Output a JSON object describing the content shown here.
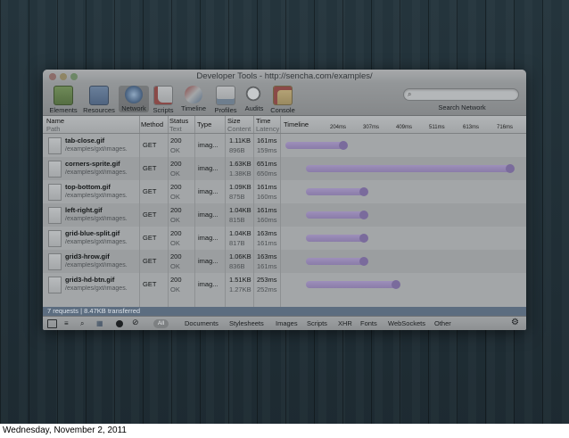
{
  "window": {
    "title": "Developer Tools - http://sencha.com/examples/"
  },
  "toolbar": {
    "items": [
      {
        "label": "Elements",
        "icon": "elements-icon"
      },
      {
        "label": "Resources",
        "icon": "resources-icon"
      },
      {
        "label": "Network",
        "icon": "network-icon"
      },
      {
        "label": "Scripts",
        "icon": "scripts-icon"
      },
      {
        "label": "Timeline",
        "icon": "timeline-icon"
      },
      {
        "label": "Profiles",
        "icon": "profiles-icon"
      },
      {
        "label": "Audits",
        "icon": "audits-icon"
      },
      {
        "label": "Console",
        "icon": "console-icon"
      }
    ],
    "search_label": "Search Network"
  },
  "headers": {
    "name": "Name",
    "path": "Path",
    "method": "Method",
    "status": "Status",
    "text": "Text",
    "type": "Type",
    "size": "Size",
    "content": "Content",
    "time": "Time",
    "latency": "Latency",
    "timeline": "Timeline",
    "ticks": [
      "204ms",
      "307ms",
      "409ms",
      "511ms",
      "613ms",
      "716ms"
    ]
  },
  "rows": [
    {
      "name": "tab-close.gif",
      "path": "/examples/gxt/images.",
      "method": "GET",
      "status": "200",
      "text": "OK",
      "type": "imag...",
      "size": "1.11KB",
      "content": "896B",
      "time": "161ms",
      "latency": "159ms",
      "bar_start": 0.0,
      "bar_end": 0.27
    },
    {
      "name": "corners-sprite.gif",
      "path": "/examples/gxt/images.",
      "method": "GET",
      "status": "200",
      "text": "OK",
      "type": "imag...",
      "size": "1.63KB",
      "content": "1.38KB",
      "time": "651ms",
      "latency": "650ms",
      "bar_start": 0.09,
      "bar_end": 1.0
    },
    {
      "name": "top-bottom.gif",
      "path": "/examples/gxt/images.",
      "method": "GET",
      "status": "200",
      "text": "OK",
      "type": "imag...",
      "size": "1.09KB",
      "content": "875B",
      "time": "161ms",
      "latency": "160ms",
      "bar_start": 0.09,
      "bar_end": 0.36
    },
    {
      "name": "left-right.gif",
      "path": "/examples/gxt/images.",
      "method": "GET",
      "status": "200",
      "text": "OK",
      "type": "imag...",
      "size": "1.04KB",
      "content": "815B",
      "time": "161ms",
      "latency": "160ms",
      "bar_start": 0.09,
      "bar_end": 0.36
    },
    {
      "name": "grid-blue-split.gif",
      "path": "/examples/gxt/images.",
      "method": "GET",
      "status": "200",
      "text": "OK",
      "type": "imag...",
      "size": "1.04KB",
      "content": "817B",
      "time": "163ms",
      "latency": "161ms",
      "bar_start": 0.09,
      "bar_end": 0.36
    },
    {
      "name": "grid3-hrow.gif",
      "path": "/examples/gxt/images.",
      "method": "GET",
      "status": "200",
      "text": "OK",
      "type": "imag...",
      "size": "1.06KB",
      "content": "836B",
      "time": "163ms",
      "latency": "161ms",
      "bar_start": 0.09,
      "bar_end": 0.36
    },
    {
      "name": "grid3-hd-btn.gif",
      "path": "/examples/gxt/images.",
      "method": "GET",
      "status": "200",
      "text": "OK",
      "type": "imag...",
      "size": "1.51KB",
      "content": "1.27KB",
      "time": "253ms",
      "latency": "252ms",
      "bar_start": 0.09,
      "bar_end": 0.5
    }
  ],
  "status": {
    "summary": "7 requests  |  8.47KB transferred"
  },
  "filters": {
    "all": "All",
    "items": [
      "Documents",
      "Stylesheets",
      "Images",
      "Scripts",
      "XHR",
      "Fonts",
      "WebSockets",
      "Other"
    ]
  },
  "footer": {
    "date": "Wednesday, November 2, 2011"
  }
}
